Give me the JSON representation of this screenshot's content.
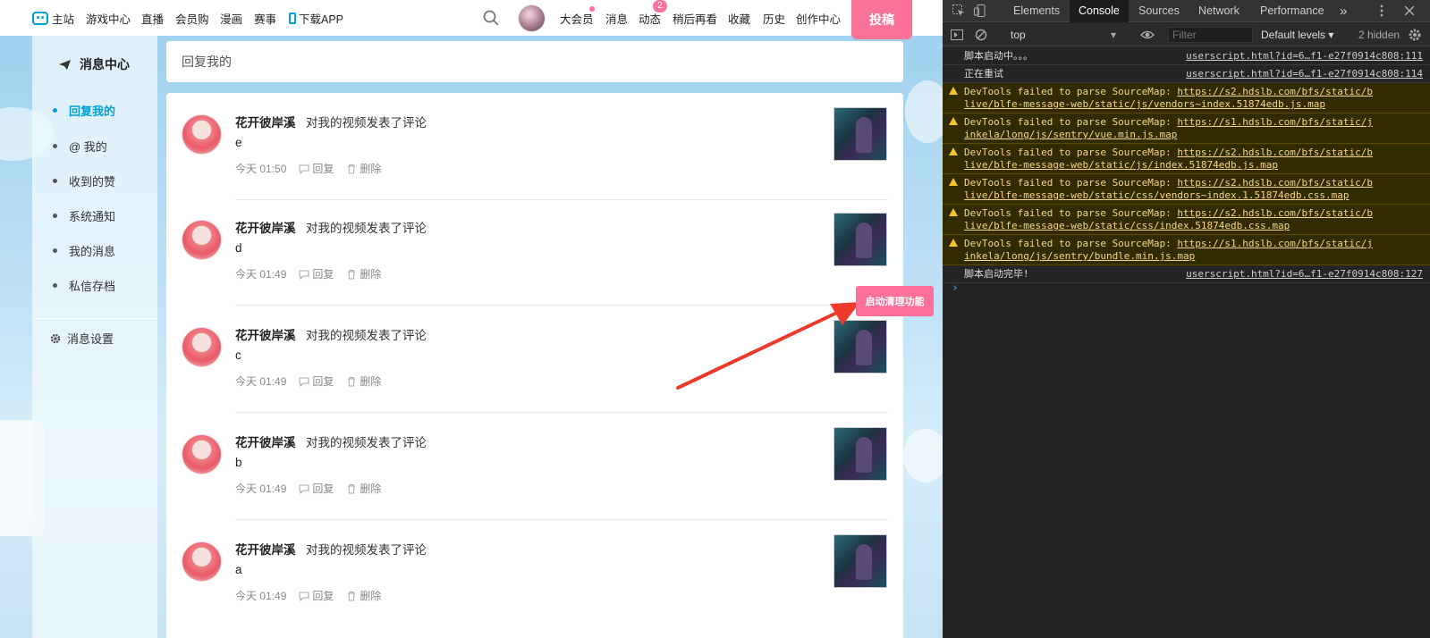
{
  "nav": {
    "home": "主站",
    "game": "游戏中心",
    "live": "直播",
    "mall": "会员购",
    "manga": "漫画",
    "match": "赛事",
    "app": "下载APP",
    "vip": "大会员",
    "message": "消息",
    "dynamic": "动态",
    "dynamic_badge": "2",
    "watch_later": "稍后再看",
    "favorites": "收藏",
    "history": "历史",
    "creator": "创作中心",
    "upload": "投稿"
  },
  "sidebar": {
    "title": "消息中心",
    "items": [
      {
        "label": "回复我的"
      },
      {
        "label": "@ 我的"
      },
      {
        "label": "收到的赞"
      },
      {
        "label": "系统通知"
      },
      {
        "label": "我的消息"
      },
      {
        "label": "私信存档"
      }
    ],
    "settings": "消息设置"
  },
  "main": {
    "heading": "回复我的",
    "replies": [
      {
        "user": "花开彼岸溪",
        "action": "对我的视频发表了评论",
        "content": "e",
        "time": "今天 01:50",
        "reply": "回复",
        "delete": "删除"
      },
      {
        "user": "花开彼岸溪",
        "action": "对我的视频发表了评论",
        "content": "d",
        "time": "今天 01:49",
        "reply": "回复",
        "delete": "删除"
      },
      {
        "user": "花开彼岸溪",
        "action": "对我的视频发表了评论",
        "content": "c",
        "time": "今天 01:49",
        "reply": "回复",
        "delete": "删除"
      },
      {
        "user": "花开彼岸溪",
        "action": "对我的视频发表了评论",
        "content": "b",
        "time": "今天 01:49",
        "reply": "回复",
        "delete": "删除"
      },
      {
        "user": "花开彼岸溪",
        "action": "对我的视频发表了评论",
        "content": "a",
        "time": "今天 01:49",
        "reply": "回复",
        "delete": "删除"
      }
    ]
  },
  "clean_button": "启动清理功能",
  "devtools": {
    "tabs": [
      "Elements",
      "Console",
      "Sources",
      "Network",
      "Performance"
    ],
    "active_tab": "Console",
    "more": "»",
    "context": "top",
    "filter_placeholder": "Filter",
    "levels": "Default levels ▾",
    "hidden": "2 hidden",
    "logs": [
      {
        "type": "info",
        "text": "脚本启动中。。。",
        "src": "userscript.html?id=6…f1-e27f0914c808:111"
      },
      {
        "type": "info",
        "text": "正在重试",
        "src": "userscript.html?id=6…f1-e27f0914c808:114"
      },
      {
        "type": "warn",
        "text": "DevTools failed to parse SourceMap: ",
        "url1": "https://s2.hdslb.com/bfs/static/b",
        "url2": "live/blfe-message-web/static/js/vendors~index.51874edb.js.map"
      },
      {
        "type": "warn",
        "text": "DevTools failed to parse SourceMap: ",
        "url1": "https://s1.hdslb.com/bfs/static/j",
        "url2": "inkela/long/js/sentry/vue.min.js.map"
      },
      {
        "type": "warn",
        "text": "DevTools failed to parse SourceMap: ",
        "url1": "https://s2.hdslb.com/bfs/static/b",
        "url2": "live/blfe-message-web/static/js/index.51874edb.js.map"
      },
      {
        "type": "warn",
        "text": "DevTools failed to parse SourceMap: ",
        "url1": "https://s2.hdslb.com/bfs/static/b",
        "url2": "live/blfe-message-web/static/css/vendors~index.1.51874edb.css.map"
      },
      {
        "type": "warn",
        "text": "DevTools failed to parse SourceMap: ",
        "url1": "https://s2.hdslb.com/bfs/static/b",
        "url2": "live/blfe-message-web/static/css/index.51874edb.css.map"
      },
      {
        "type": "warn",
        "text": "DevTools failed to parse SourceMap: ",
        "url1": "https://s1.hdslb.com/bfs/static/j",
        "url2": "inkela/long/js/sentry/bundle.min.js.map"
      },
      {
        "type": "info",
        "text": "脚本启动完毕!",
        "src": "userscript.html?id=6…f1-e27f0914c808:127"
      }
    ],
    "prompt": "›"
  }
}
